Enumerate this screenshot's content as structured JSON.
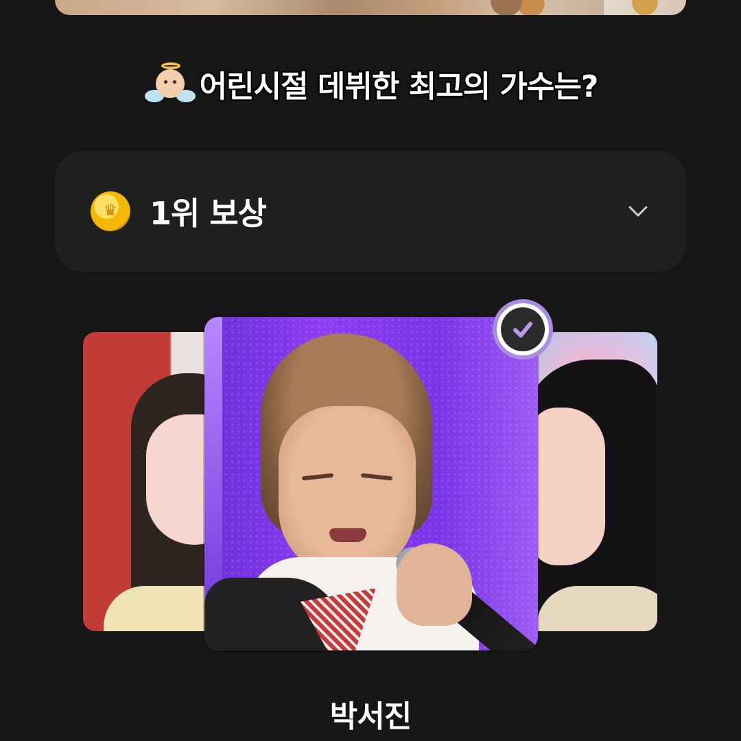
{
  "page": {
    "title": "어린시절 데뷔한 최고의 가수는?",
    "title_icon": "baby-angel-emoji"
  },
  "reward": {
    "label": "1위 보상",
    "icon": "gold-coin-icon",
    "expand_icon": "chevron-down-icon"
  },
  "carousel": {
    "cards": [
      {
        "position": "left",
        "selected": false
      },
      {
        "position": "center",
        "selected": true
      },
      {
        "position": "right",
        "selected": false
      }
    ],
    "selected_icon": "check-icon",
    "accent_color": "#a98be0"
  },
  "selected_name": "박서진"
}
